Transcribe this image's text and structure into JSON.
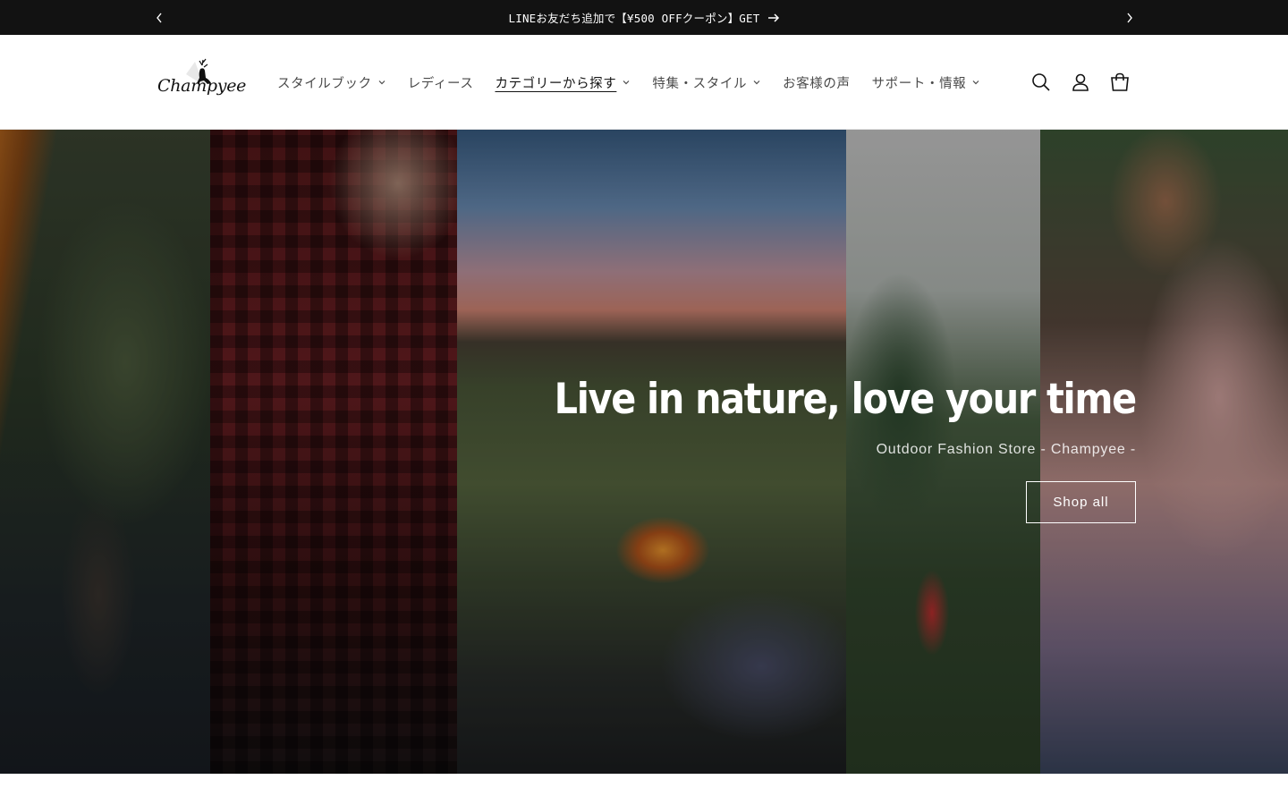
{
  "announcement": {
    "text": "LINEお友だち追加で【¥500 OFFクーポン】GET",
    "prev_icon": "chevron-left-icon",
    "next_icon": "chevron-right-icon",
    "arrow_icon": "arrow-right-icon"
  },
  "header": {
    "logo_text": "Champyee",
    "nav": [
      {
        "label": "スタイルブック",
        "has_dropdown": true
      },
      {
        "label": "レディース",
        "has_dropdown": false
      },
      {
        "label": "カテゴリーから探す",
        "has_dropdown": true,
        "active": true
      },
      {
        "label": "特集・スタイル",
        "has_dropdown": true
      },
      {
        "label": "お客様の声",
        "has_dropdown": false
      },
      {
        "label": "サポート・情報",
        "has_dropdown": true
      }
    ],
    "icons": [
      "search-icon",
      "account-icon",
      "cart-icon"
    ]
  },
  "hero": {
    "title": "Live in nature, love your time",
    "subtitle": "Outdoor Fashion Store - Champyee -",
    "button_label": "Shop all"
  },
  "colors": {
    "announcement_bg": "#121212",
    "text": "#121212",
    "nav_text": "#4a4a4a",
    "hero_text": "#ffffff"
  }
}
